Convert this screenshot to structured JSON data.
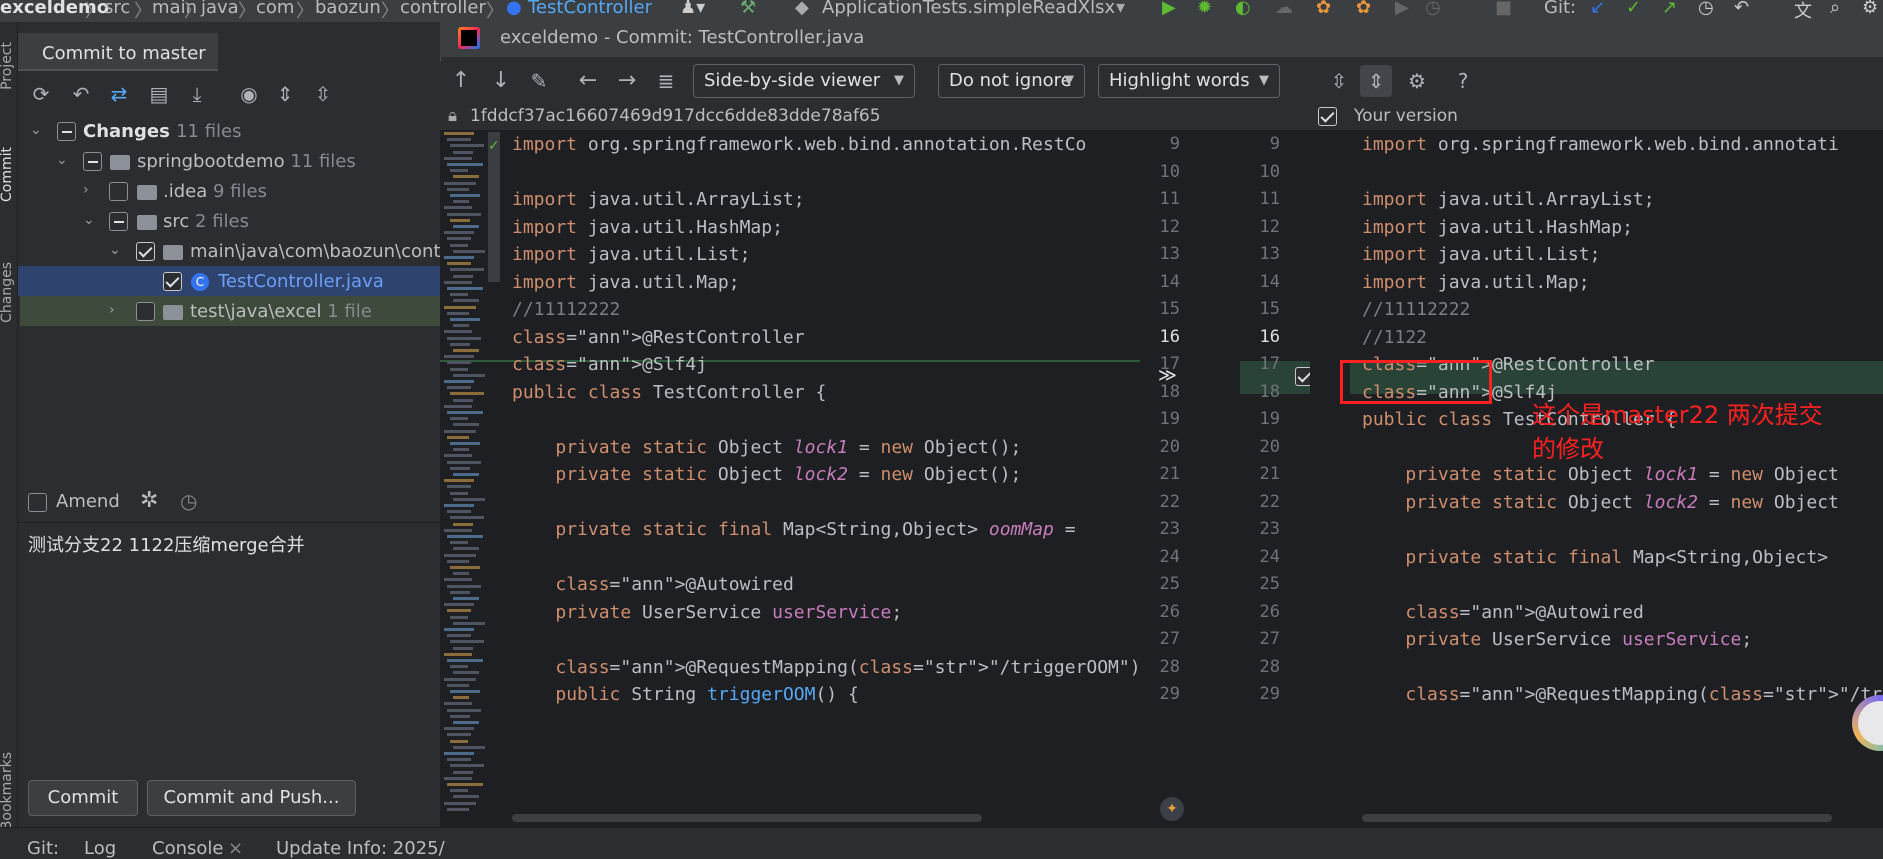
{
  "breadcrumb": [
    "exceldemo",
    "src",
    "main",
    "java",
    "com",
    "baozun",
    "controller",
    "TestController"
  ],
  "topbar": {
    "run_config": "ApplicationTests.simpleReadXlsx",
    "git_label": "Git:"
  },
  "left_strip": {
    "project": "Project",
    "commit": "Commit",
    "changes": "Changes",
    "bookmarks": "Bookmarks"
  },
  "commit_panel": {
    "tab_title": "Commit to master",
    "tree": [
      {
        "label": "Changes",
        "count": "11 files"
      },
      {
        "label": "springbootdemo",
        "count": "11 files"
      },
      {
        "label": ".idea",
        "count": "9 files"
      },
      {
        "label": "src",
        "count": "2 files"
      },
      {
        "label": "main\\java\\com\\baozun\\controller",
        "count": ""
      },
      {
        "label": "TestController.java",
        "count": ""
      },
      {
        "label": "test\\java\\excel",
        "count": "1 file"
      }
    ],
    "amend_label": "Amend",
    "message": "测试分支22 1122压缩merge合并",
    "commit_button": "Commit",
    "commit_push_button": "Commit and Push..."
  },
  "bottom_bar": {
    "git": "Git:",
    "log": "Log",
    "console": "Console",
    "update_info": "Update Info: 2025/"
  },
  "diff_window": {
    "title": "exceldemo - Commit: TestController.java",
    "viewer": "Side-by-side viewer",
    "whitespace": "Do not ignore",
    "highlight": "Highlight words",
    "help": "?",
    "left_revision": "1fddcf37ac16607469d917dcc6dde83dde78af65",
    "right_label": "Your version",
    "annotation": "这个是master22 两次提交的修改",
    "annotation_line1": "这个是master22 两次提交",
    "annotation_line2": "的修改",
    "left_line_numbers": [
      "9",
      "10",
      "11",
      "12",
      "13",
      "14",
      "15",
      "16",
      "17",
      "18",
      "19",
      "20",
      "21",
      "22",
      "23",
      "24",
      "25",
      "26",
      "27",
      "28",
      "29"
    ],
    "right_line_numbers": [
      "9",
      "10",
      "11",
      "12",
      "13",
      "14",
      "15",
      "16",
      "17",
      "18",
      "19",
      "20",
      "21",
      "22",
      "23",
      "24",
      "25",
      "26",
      "27",
      "28",
      "29"
    ],
    "left_code": [
      "import org.springframework.web.bind.annotation.RestCo",
      "",
      "import java.util.ArrayList;",
      "import java.util.HashMap;",
      "import java.util.List;",
      "import java.util.Map;",
      "//11112222",
      "@RestController",
      "@Slf4j",
      "public class TestController {",
      "",
      "    private static Object lock1 = new Object();",
      "    private static Object lock2 = new Object();",
      "",
      "    private static final Map<String,Object> oomMap =",
      "",
      "    @Autowired",
      "    private UserService userService;",
      "",
      "    @RequestMapping(\"/triggerOOM\")",
      "    public String triggerOOM() {"
    ],
    "right_code": [
      "import org.springframework.web.bind.annotati",
      "",
      "import java.util.ArrayList;",
      "import java.util.HashMap;",
      "import java.util.List;",
      "import java.util.Map;",
      "//11112222",
      "//1122",
      "@RestController",
      "@Slf4j",
      "public class TestController {",
      "",
      "    private static Object lock1 = new Object",
      "    private static Object lock2 = new Object",
      "",
      "    private static final Map<String,Object>",
      "",
      "    @Autowired",
      "    private UserService userService;",
      "",
      "    @RequestMapping(\"/triggerOOM\")"
    ]
  },
  "colors": {
    "accent": "#3574f0",
    "added": "#294436",
    "annotation_red": "#ff2020"
  }
}
